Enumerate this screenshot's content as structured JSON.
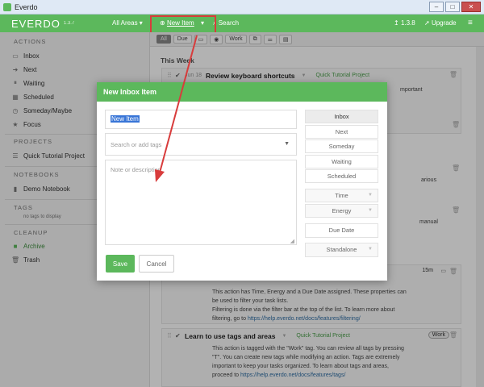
{
  "window": {
    "title": "Everdo"
  },
  "appbar": {
    "brand": "EVERDO",
    "version": "1.3.7",
    "areas_label": "All Areas ▾",
    "new_item_label": "New Item",
    "search_label": "Search",
    "sync_version": "1.3.8",
    "upgrade_label": "Upgrade"
  },
  "filterbar": {
    "chips": [
      "All",
      "Due",
      "Work"
    ]
  },
  "sidebar": {
    "actions_header": "ACTIONS",
    "actions": [
      "Inbox",
      "Next",
      "Waiting",
      "Scheduled",
      "Someday/Maybe",
      "Focus"
    ],
    "projects_header": "PROJECTS",
    "projects": [
      "Quick Tutorial Project"
    ],
    "notebooks_header": "NOTEBOOKS",
    "notebooks": [
      "Demo Notebook"
    ],
    "tags_header": "TAGS",
    "tags_empty": "no tags to display",
    "cleanup_header": "CLEANUP",
    "cleanup": [
      "Archive",
      "Trash"
    ]
  },
  "main": {
    "week_header": "This Week",
    "task1": {
      "date": "Jun 18",
      "title": "Review keyboard shortcuts",
      "project": "Quick Tutorial Project"
    },
    "frag1": "mportant",
    "frag2": "arious",
    "frag3": "manual",
    "task2": {
      "time_est": "15m",
      "body1": "This action has Time, Energy and a Due Date assigned. These properties can",
      "body2": "be used to filter your task lists.",
      "body3": "Filtering is done via the filter bar at the top of the list. To learn more about",
      "body4_prefix": "filtering, go to ",
      "body4_link": "https://help.everdo.net/docs/features/filtering/"
    },
    "task3": {
      "title": "Learn to use tags and areas",
      "project": "Quick Tutorial Project",
      "tag": "Work",
      "body1": "This action is tagged with the \"Work\" tag. You can review all tags by pressing",
      "body2": "\"T\". You can create new tags while modifying an action. Tags are extremely",
      "body3": "important to keep your tasks organized. To learn about tags and areas,",
      "body4_prefix": "proceed to ",
      "body4_link": "https://help.everdo.net/docs/features/tags/"
    }
  },
  "modal": {
    "title": "New Inbox Item",
    "name_value": "New Item",
    "tags_placeholder": "Search or add tags",
    "note_placeholder": "Note or description",
    "save_label": "Save",
    "cancel_label": "Cancel",
    "lists": [
      "Inbox",
      "Next",
      "Someday",
      "Waiting",
      "Scheduled"
    ],
    "selected_list": "Inbox",
    "time_label": "Time",
    "energy_label": "Energy",
    "due_label": "Due Date",
    "standalone_label": "Standalone"
  },
  "colors": {
    "brand_green": "#5cb85c",
    "highlight_red": "#d83c3c"
  }
}
